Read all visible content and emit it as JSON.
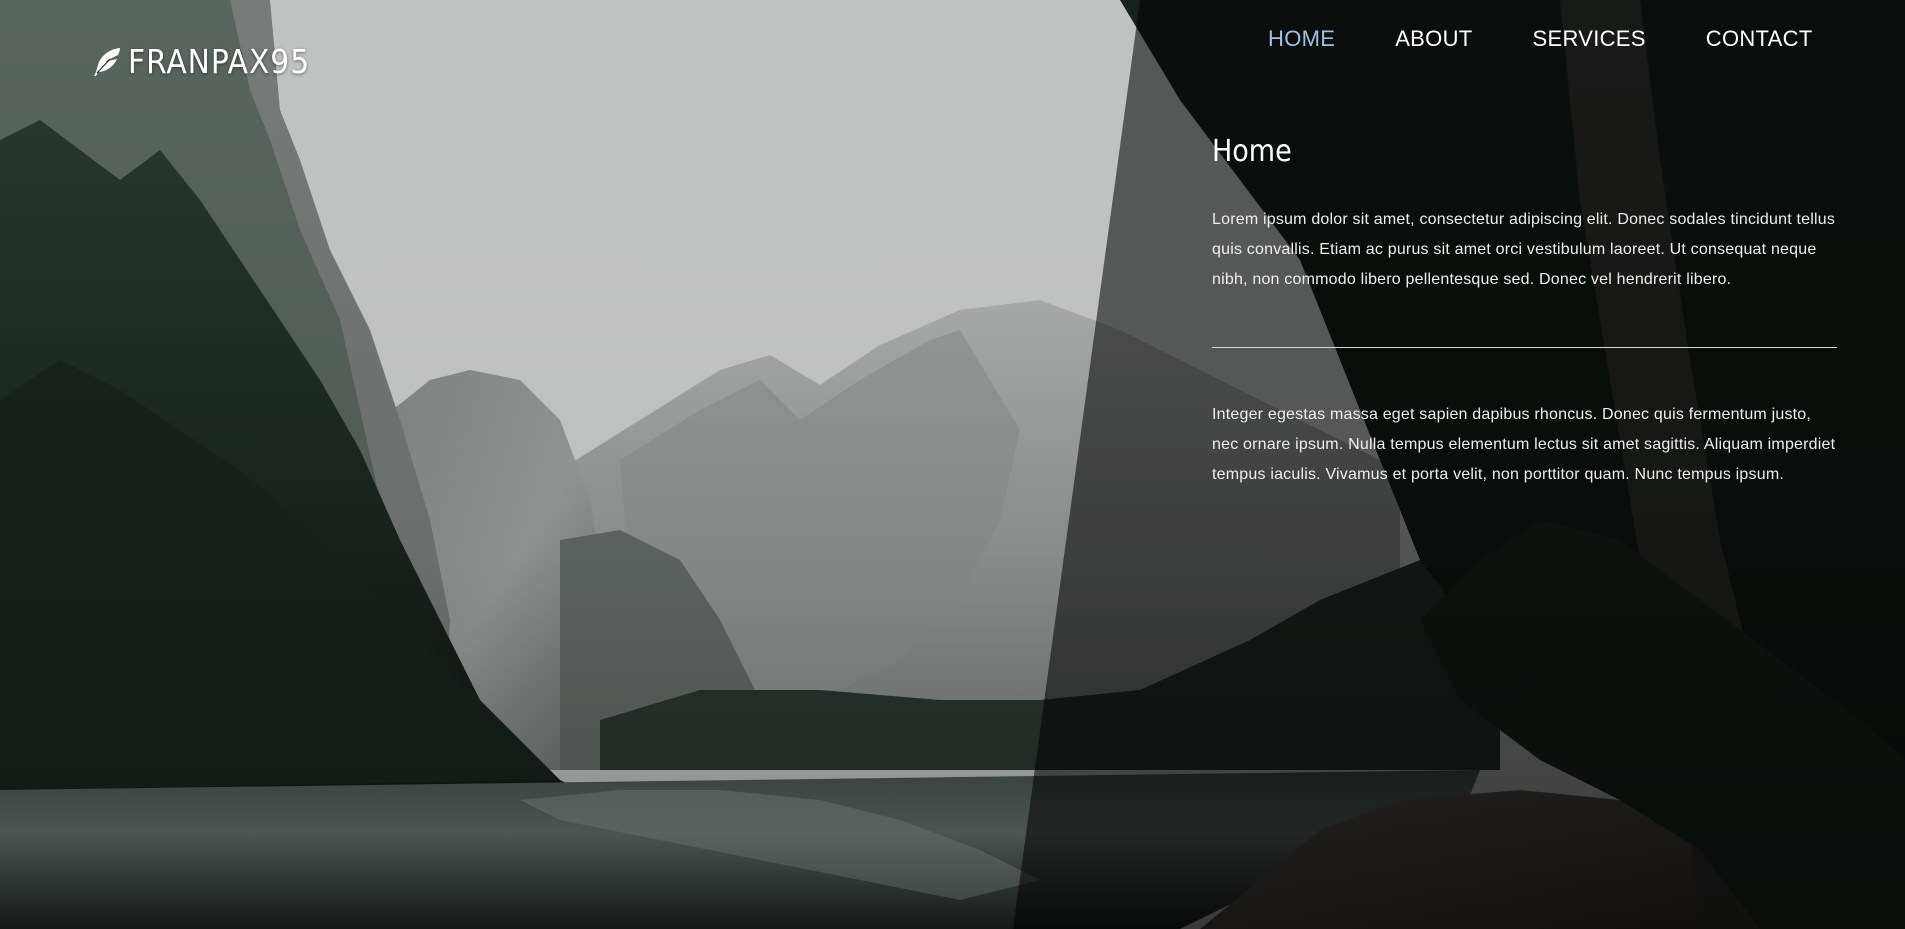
{
  "brand": {
    "name": "FRANPAX95",
    "icon": "feather-icon"
  },
  "nav": {
    "items": [
      {
        "label": "HOME",
        "active": true
      },
      {
        "label": "ABOUT",
        "active": false
      },
      {
        "label": "SERVICES",
        "active": false
      },
      {
        "label": "CONTACT",
        "active": false
      }
    ]
  },
  "main": {
    "heading": "Home",
    "paragraph_1": "Lorem ipsum dolor sit amet, consectetur adipiscing elit. Donec sodales tincidunt tellus quis convallis. Etiam ac purus sit amet orci vestibulum laoreet. Ut consequat neque nibh, non commodo libero pellentesque sed. Donec vel hendrerit libero.",
    "paragraph_2": "Integer egestas massa eget sapien dapibus rhoncus. Donec quis fermentum justo, nec ornare ipsum. Nulla tempus elementum lectus sit amet sagittis. Aliquam imperdiet tempus iaculis. Vivamus et porta velit, non porttitor quam. Nunc tempus ipsum."
  },
  "colors": {
    "active_nav": "#9fc0e0",
    "text": "#ffffff",
    "overlay": "#000000"
  }
}
